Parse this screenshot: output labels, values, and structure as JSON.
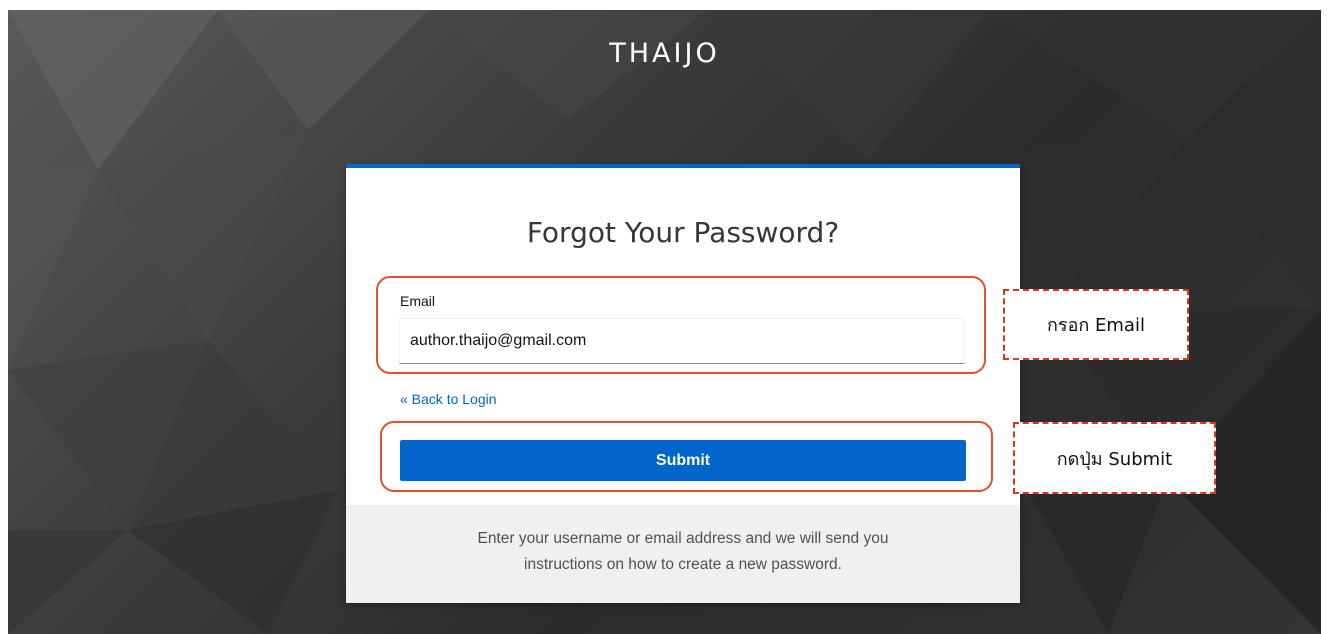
{
  "brand": {
    "title": "THAIJO"
  },
  "form": {
    "title": "Forgot Your Password?",
    "email_label": "Email",
    "email_value": "author.thaijo@gmail.com",
    "back_link": "« Back to Login",
    "submit_label": "Submit"
  },
  "footer": {
    "line1": "Enter your username or email address and we will send you",
    "line2": "instructions on how to create a new password."
  },
  "annotations": {
    "email_callout": "กรอก Email",
    "submit_callout": "กดปุ่ม Submit",
    "highlight_color": "#e0522d"
  },
  "colors": {
    "accent": "#0066cc",
    "footer_bg": "#f0f0f0"
  }
}
